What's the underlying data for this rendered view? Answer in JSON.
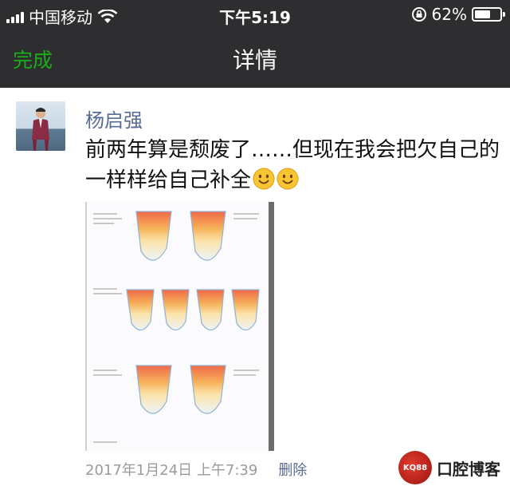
{
  "status_bar": {
    "carrier": "中国移动",
    "time": "下午5:19",
    "battery_percent": "62%",
    "battery_level": 0.62,
    "icons": [
      "signal-icon",
      "wifi-icon",
      "rotation-lock-icon",
      "battery-icon"
    ]
  },
  "nav": {
    "done_label": "完成",
    "title": "详情"
  },
  "post": {
    "author": "杨启强",
    "text": "前两年算是颓废了……但现在我会把欠自己的一样样给自己补全",
    "emojis": [
      "smile-emoji",
      "smile-emoji"
    ],
    "timestamp": "2017年1月24日 上午7:39",
    "delete_label": "删除"
  },
  "watermark": {
    "logo_text": "KQ88",
    "text": "口腔博客"
  },
  "colors": {
    "bar_background": "#2e2e30",
    "accent_green": "#1aad19",
    "link_blue": "#576b95",
    "meta_gray": "#9b9b9b"
  }
}
